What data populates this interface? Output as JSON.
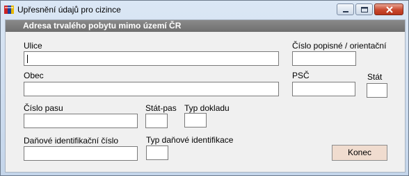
{
  "window": {
    "title": "Upřesnění údajů pro cizince"
  },
  "section": {
    "title": "Adresa trvalého pobytu mimo území ČR"
  },
  "fields": {
    "ulice": {
      "label": "Ulice",
      "value": ""
    },
    "cislo_popisne": {
      "label": "Číslo popisné / orientační",
      "value": ""
    },
    "obec": {
      "label": "Obec",
      "value": ""
    },
    "psc": {
      "label": "PSČ",
      "value": ""
    },
    "stat": {
      "label": "Stát",
      "value": ""
    },
    "cislo_pasu": {
      "label": "Číslo pasu",
      "value": ""
    },
    "stat_pas": {
      "label": "Stát-pas",
      "value": ""
    },
    "typ_dokladu": {
      "label": "Typ dokladu",
      "value": ""
    },
    "dic": {
      "label": "Daňové identifikační číslo",
      "value": ""
    },
    "typ_dic": {
      "label": "Typ daňové identifikace",
      "value": ""
    }
  },
  "buttons": {
    "konec": "Konec"
  }
}
